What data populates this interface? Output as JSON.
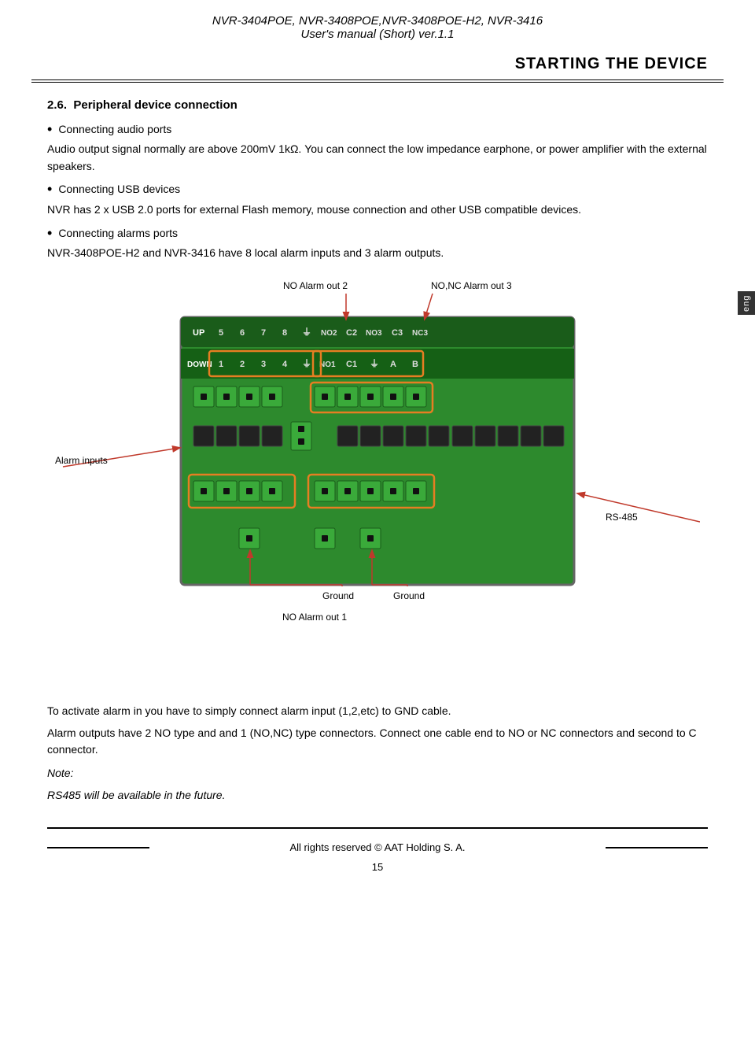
{
  "header": {
    "line1": "NVR-3404POE, NVR-3408POE,NVR-3408POE-H2, NVR-3416",
    "line2": "User's manual (Short) ver.1.1"
  },
  "section_title": "STARTING THE DEVICE",
  "section_number": "2.6.",
  "section_heading": "Peripheral device connection",
  "bullets": [
    "Connecting audio ports",
    "Connecting USB devices",
    "Connecting alarms ports"
  ],
  "paragraphs": {
    "audio": "Audio output signal normally are above 200mV 1kΩ. You can connect the low impedance earphone, or  power amplifier with the external speakers.",
    "usb": "NVR has 2 x USB 2.0 ports for external Flash memory, mouse connection and other USB compatible devices.",
    "alarms": "NVR-3408POE-H2 and NVR-3416 have 8 local alarm inputs and 3 alarm outputs."
  },
  "diagram_labels": {
    "no_alarm_out2": "NO Alarm out 2",
    "nonc_alarm_out3": "NO,NC Alarm out 3",
    "alarm_inputs": "Alarm inputs",
    "rs485": "RS-485",
    "ground1": "Ground",
    "ground2": "Ground",
    "no_alarm_out1": "NO Alarm out 1"
  },
  "bottom_paragraphs": {
    "activate": "To activate alarm in you have to simply connect alarm input (1,2,etc) to GND cable.",
    "alarm_outputs": "Alarm outputs have 2 NO type and  and 1 (NO,NC) type connectors. Connect one cable end to NO or NC connectors and second to C connector.",
    "note_label": "Note:",
    "note_text": "RS485 will be available in the future."
  },
  "footer": {
    "copyright": "All rights reserved © AAT Holding S. A.",
    "page": "15"
  },
  "eng_badge": "eng"
}
